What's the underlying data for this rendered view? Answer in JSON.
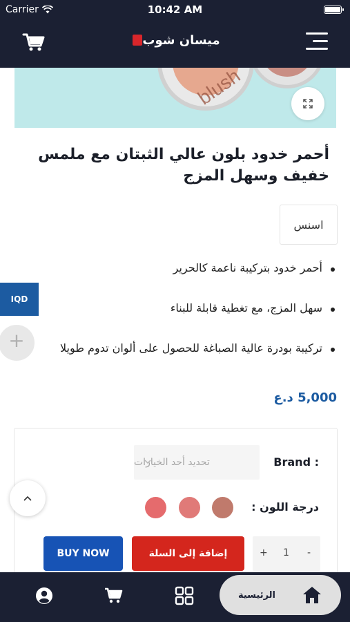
{
  "status_bar": {
    "carrier": "Carrier",
    "time": "10:42 AM"
  },
  "header": {
    "brand_name": "ميسان شوب",
    "cart_icon": "cart-icon",
    "menu_icon": "menu-icon"
  },
  "product": {
    "image_caption": "blush",
    "title": "أحمر خدود بلون عالي الثبتان مع ملمس خفيف وسهل المزج",
    "brand": "اسنس",
    "features": [
      "أحمر خدود بتركيبة ناعمة كالحرير",
      "سهل المزج، مع تغطية قابلة للبناء",
      "تركيبة بودرة عالية الصباغة للحصول على ألوان تدوم طويلا"
    ],
    "price": "5,000 د.ع"
  },
  "currency_tab": "IQD",
  "options": {
    "brand_label": "Brand :",
    "brand_select_placeholder": "تحديد أحد الخيارات",
    "color_label": "درجة اللون :",
    "swatches": [
      "#c07a6c",
      "#e07a78",
      "#e56b6d"
    ],
    "quantity": {
      "value": "1",
      "minus": "-",
      "plus": "+"
    },
    "add_to_cart": "إضافة إلى السلة",
    "buy_now": "BUY NOW"
  },
  "bottom_nav": {
    "home_label": "الرئيسية",
    "items": [
      "home-icon",
      "grid-icon",
      "cart-icon",
      "account-icon"
    ]
  },
  "colors": {
    "nav_bg": "#1b2033",
    "price": "#1c5ba1",
    "add_to_cart": "#d4261d",
    "buy_now": "#1753b5"
  }
}
